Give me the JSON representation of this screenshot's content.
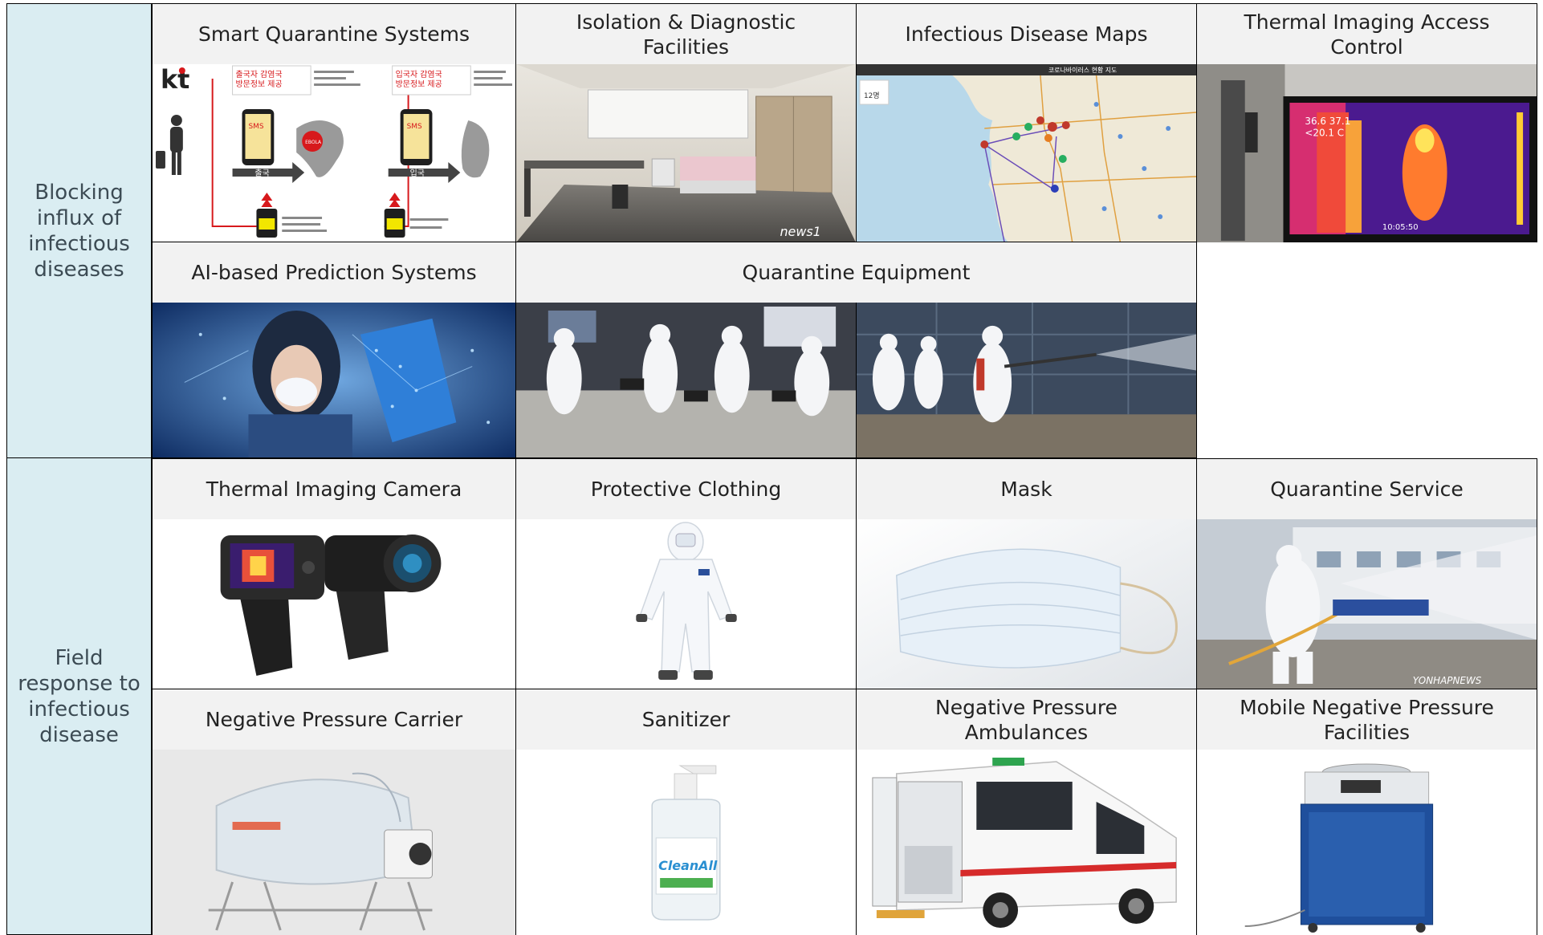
{
  "sections": {
    "blocking": "Blocking\ninflux of\ninfectious\ndiseases",
    "field": "Field\nresponse to\ninfectious\ndisease"
  },
  "captions": {
    "smart_quarantine": "Smart Quarantine Systems",
    "isolation_facilities": "Isolation & Diagnostic\nFacilities",
    "disease_maps": "Infectious Disease Maps",
    "thermal_access": "Thermal Imaging Access\nControl",
    "ai_prediction": "AI-based Prediction Systems",
    "quarantine_equipment": "Quarantine Equipment",
    "thermal_camera": "Thermal Imaging Camera",
    "protective_clothing": "Protective Clothing",
    "mask": "Mask",
    "quarantine_service": "Quarantine Service",
    "neg_carrier": "Negative Pressure Carrier",
    "sanitizer": "Sanitizer",
    "neg_ambulance": "Negative Pressure\nAmbulances",
    "mobile_neg": "Mobile Negative Pressure\nFacilities"
  },
  "image_text": {
    "kt_logo": "kt",
    "sms": "SMS",
    "outbound_title": "출국자 감염국\n방문정보 제공",
    "inbound_title": "입국자 감염국\n방문정보 제공",
    "depart": "출국",
    "arrive": "입국",
    "ebola": "EBOLA",
    "news1": "news1",
    "map_header": "코로나바이러스 현황 지도",
    "map_count": "12명",
    "thermal_readout": "36.6 37.1\n<20.1 C",
    "thermal_time": "10:05:50",
    "yonhap": "YONHAPNEWS",
    "cleanall": "CleanAll"
  },
  "colors": {
    "section_bg": "#daedf2",
    "caption_bg": "#f2f2f2",
    "kt_red": "#d7191c"
  }
}
